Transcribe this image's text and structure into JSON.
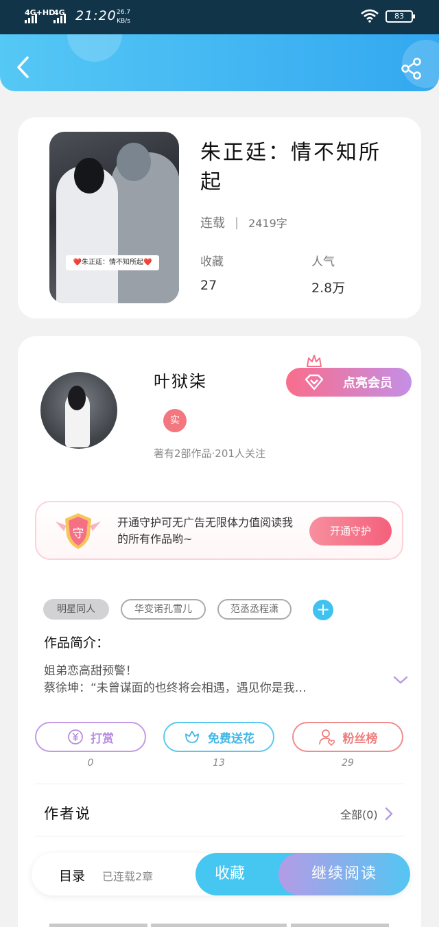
{
  "status_bar": {
    "network1": "4G+HD",
    "network2": "4G",
    "time": "21:20",
    "speed_value": "26.7",
    "speed_unit": "KB/s",
    "battery": "83",
    "icons": [
      "signal-icon",
      "wifi-icon",
      "battery-icon"
    ]
  },
  "header": {
    "back_icon": "back-arrow-icon",
    "share_icon": "share-icon"
  },
  "book": {
    "cover_caption": "❤️朱正廷：情不知所起❤️",
    "title": "朱正廷：情不知所起",
    "status": "连载",
    "separator": "|",
    "word_count": "2419字",
    "collect_label": "收藏",
    "collect_value": "27",
    "popularity_label": "人气",
    "popularity_value": "2.8万"
  },
  "author": {
    "name": "叶狱柒",
    "badge": "实",
    "meta": "著有2部作品·201人关注",
    "vip_button": "点亮会员",
    "colors": {
      "vip_gradient_start": "#f96d8b",
      "vip_gradient_end": "#c48fe6"
    }
  },
  "guard": {
    "shield_char": "守",
    "text": "开通守护可无广告无限体力值阅读我的所有作品哟~",
    "button": "开通守护"
  },
  "tags": [
    {
      "label": "明星同人"
    },
    {
      "label": "华变诺孔雪儿"
    },
    {
      "label": "范丞丞程潇"
    }
  ],
  "tag_add": "+",
  "intro": {
    "label": "作品简介：",
    "line1": "姐弟恋高甜预警！",
    "line2": "蔡徐坤：“未曾谋面的也终将会相遇，遇见你是我…"
  },
  "actions": [
    {
      "label": "打赏",
      "icon": "yen-icon",
      "count": "0"
    },
    {
      "label": "免费送花",
      "icon": "flower-icon",
      "count": "13"
    },
    {
      "label": "粉丝榜",
      "icon": "fans-icon",
      "count": "29"
    }
  ],
  "author_say": {
    "label": "作者说",
    "all": "全部(0)"
  },
  "bottom_bar": {
    "toc": "目录",
    "chapters": "已连载2章",
    "favorite": "收藏",
    "continue": "继续阅读",
    "colors": {
      "favorite": "#45c7f2",
      "accent": "#b49be6"
    }
  }
}
